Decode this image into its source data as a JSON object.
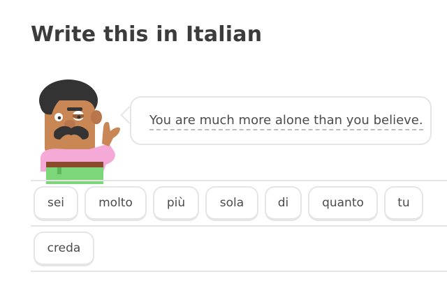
{
  "header": {
    "title": "Write this in Italian"
  },
  "prompt": {
    "sentence": "You are much more alone than you believe."
  },
  "word_bank": [
    "sei",
    "molto",
    "più",
    "sola",
    "di",
    "quanto",
    "tu",
    "creda"
  ],
  "colors": {
    "shirt": "#f5a9d6",
    "pants": "#7ed67a",
    "skin": "#c98755",
    "hair": "#333333"
  },
  "icons": {
    "character": "duolingo-character-oscar"
  }
}
